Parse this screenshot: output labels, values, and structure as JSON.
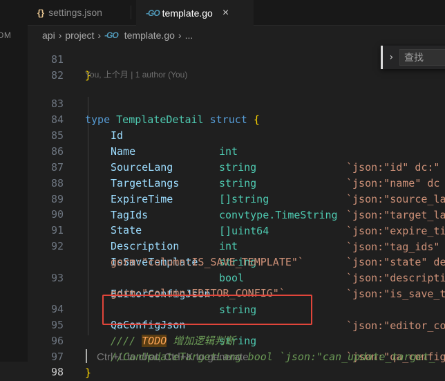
{
  "sidebar": {
    "clipped_text": "OM"
  },
  "tabs": {
    "inactive": {
      "icon": "{}",
      "label": "settings.json"
    },
    "active": {
      "icon": "GO",
      "label": "template.go",
      "close": "×"
    }
  },
  "breadcrumb": {
    "items": [
      "api",
      "project",
      "template.go",
      "..."
    ],
    "sep": "›"
  },
  "find": {
    "toggle": "›",
    "placeholder": "查找"
  },
  "blame": "You, 上个月 | 1 author (You)",
  "lines": {
    "l81": "81",
    "l82": "82",
    "l83": "83",
    "l84": "84",
    "l85": "85",
    "l86": "86",
    "l87": "87",
    "l88": "88",
    "l89": "89",
    "l90": "90",
    "l91": "91",
    "l92": "92",
    "l93": "93",
    "l94": "94",
    "l95": "95",
    "l96": "96",
    "l97": "97",
    "l98": "98"
  },
  "code": {
    "l81": "}",
    "l83_kw": "type",
    "l83_name": "TemplateDetail",
    "l83_kw2": "struct",
    "l83_brace": "{",
    "l84_f": "Id",
    "l84_t": "int",
    "l84_tag": "`json:\"id\" dc:\"",
    "l85_f": "Name",
    "l85_t": "string",
    "l85_tag": "`json:\"name\" dc",
    "l86_f": "SourceLang",
    "l86_t": "string",
    "l86_tag": "`json:\"source_la",
    "l87_f": "TargetLangs",
    "l87_t": "[]string",
    "l87_tag": "`json:\"target_la",
    "l88_f": "ExpireTime",
    "l88_pkg": "convtype",
    "l88_t": ".TimeString",
    "l88_tag": "`json:\"expire_ti",
    "l89_f": "TagIds",
    "l89_t": "[]uint64",
    "l89_tag": "`json:\"tag_ids\"",
    "l90_f": "State",
    "l90_t": "int",
    "l90_tag": "`json:\"state\" de",
    "l91_f": "Description",
    "l91_t": "string",
    "l91_tag": "`json:\"descripti",
    "l92_f": "IsSaveTemplate",
    "l92_t": "bool",
    "l92_tag": "`json:\"is_save_t",
    "l92_wrap": "gorm:\"column:IS_SAVE_TEMPLATE\"`",
    "l93_f": "EditorConfigJson",
    "l93_t": "string",
    "l93_tag": "`json:\"editor_co",
    "l93_wrap": "gorm:\"column:EDITOR_CONFIG\"`",
    "l94_f": "QaConfigJson",
    "l94_t": "string",
    "l94_tag": "`json:\"qa_config",
    "l95_c1": "//// ",
    "l95_todo": "TODO",
    "l95_c2": " 增加逻辑判断",
    "l96_c": "//CanUpdateTargetLang bool `json:\"can_update_target_",
    "l97": "}"
  },
  "ghost_hint": "Ctrl+L to chat, Ctrl+K to generate"
}
